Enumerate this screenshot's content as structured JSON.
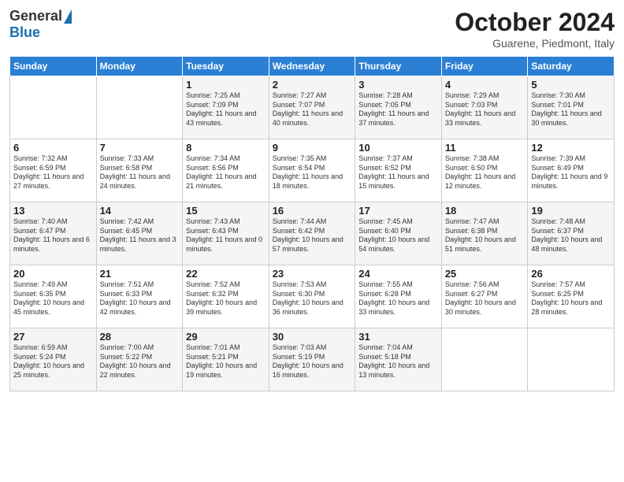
{
  "header": {
    "logo_general": "General",
    "logo_blue": "Blue",
    "title": "October 2024",
    "location": "Guarene, Piedmont, Italy"
  },
  "weekdays": [
    "Sunday",
    "Monday",
    "Tuesday",
    "Wednesday",
    "Thursday",
    "Friday",
    "Saturday"
  ],
  "weeks": [
    [
      {
        "day": "",
        "info": ""
      },
      {
        "day": "",
        "info": ""
      },
      {
        "day": "1",
        "info": "Sunrise: 7:25 AM\nSunset: 7:09 PM\nDaylight: 11 hours and 43 minutes."
      },
      {
        "day": "2",
        "info": "Sunrise: 7:27 AM\nSunset: 7:07 PM\nDaylight: 11 hours and 40 minutes."
      },
      {
        "day": "3",
        "info": "Sunrise: 7:28 AM\nSunset: 7:05 PM\nDaylight: 11 hours and 37 minutes."
      },
      {
        "day": "4",
        "info": "Sunrise: 7:29 AM\nSunset: 7:03 PM\nDaylight: 11 hours and 33 minutes."
      },
      {
        "day": "5",
        "info": "Sunrise: 7:30 AM\nSunset: 7:01 PM\nDaylight: 11 hours and 30 minutes."
      }
    ],
    [
      {
        "day": "6",
        "info": "Sunrise: 7:32 AM\nSunset: 6:59 PM\nDaylight: 11 hours and 27 minutes."
      },
      {
        "day": "7",
        "info": "Sunrise: 7:33 AM\nSunset: 6:58 PM\nDaylight: 11 hours and 24 minutes."
      },
      {
        "day": "8",
        "info": "Sunrise: 7:34 AM\nSunset: 6:56 PM\nDaylight: 11 hours and 21 minutes."
      },
      {
        "day": "9",
        "info": "Sunrise: 7:35 AM\nSunset: 6:54 PM\nDaylight: 11 hours and 18 minutes."
      },
      {
        "day": "10",
        "info": "Sunrise: 7:37 AM\nSunset: 6:52 PM\nDaylight: 11 hours and 15 minutes."
      },
      {
        "day": "11",
        "info": "Sunrise: 7:38 AM\nSunset: 6:50 PM\nDaylight: 11 hours and 12 minutes."
      },
      {
        "day": "12",
        "info": "Sunrise: 7:39 AM\nSunset: 6:49 PM\nDaylight: 11 hours and 9 minutes."
      }
    ],
    [
      {
        "day": "13",
        "info": "Sunrise: 7:40 AM\nSunset: 6:47 PM\nDaylight: 11 hours and 6 minutes."
      },
      {
        "day": "14",
        "info": "Sunrise: 7:42 AM\nSunset: 6:45 PM\nDaylight: 11 hours and 3 minutes."
      },
      {
        "day": "15",
        "info": "Sunrise: 7:43 AM\nSunset: 6:43 PM\nDaylight: 11 hours and 0 minutes."
      },
      {
        "day": "16",
        "info": "Sunrise: 7:44 AM\nSunset: 6:42 PM\nDaylight: 10 hours and 57 minutes."
      },
      {
        "day": "17",
        "info": "Sunrise: 7:45 AM\nSunset: 6:40 PM\nDaylight: 10 hours and 54 minutes."
      },
      {
        "day": "18",
        "info": "Sunrise: 7:47 AM\nSunset: 6:38 PM\nDaylight: 10 hours and 51 minutes."
      },
      {
        "day": "19",
        "info": "Sunrise: 7:48 AM\nSunset: 6:37 PM\nDaylight: 10 hours and 48 minutes."
      }
    ],
    [
      {
        "day": "20",
        "info": "Sunrise: 7:49 AM\nSunset: 6:35 PM\nDaylight: 10 hours and 45 minutes."
      },
      {
        "day": "21",
        "info": "Sunrise: 7:51 AM\nSunset: 6:33 PM\nDaylight: 10 hours and 42 minutes."
      },
      {
        "day": "22",
        "info": "Sunrise: 7:52 AM\nSunset: 6:32 PM\nDaylight: 10 hours and 39 minutes."
      },
      {
        "day": "23",
        "info": "Sunrise: 7:53 AM\nSunset: 6:30 PM\nDaylight: 10 hours and 36 minutes."
      },
      {
        "day": "24",
        "info": "Sunrise: 7:55 AM\nSunset: 6:28 PM\nDaylight: 10 hours and 33 minutes."
      },
      {
        "day": "25",
        "info": "Sunrise: 7:56 AM\nSunset: 6:27 PM\nDaylight: 10 hours and 30 minutes."
      },
      {
        "day": "26",
        "info": "Sunrise: 7:57 AM\nSunset: 6:25 PM\nDaylight: 10 hours and 28 minutes."
      }
    ],
    [
      {
        "day": "27",
        "info": "Sunrise: 6:59 AM\nSunset: 5:24 PM\nDaylight: 10 hours and 25 minutes."
      },
      {
        "day": "28",
        "info": "Sunrise: 7:00 AM\nSunset: 5:22 PM\nDaylight: 10 hours and 22 minutes."
      },
      {
        "day": "29",
        "info": "Sunrise: 7:01 AM\nSunset: 5:21 PM\nDaylight: 10 hours and 19 minutes."
      },
      {
        "day": "30",
        "info": "Sunrise: 7:03 AM\nSunset: 5:19 PM\nDaylight: 10 hours and 16 minutes."
      },
      {
        "day": "31",
        "info": "Sunrise: 7:04 AM\nSunset: 5:18 PM\nDaylight: 10 hours and 13 minutes."
      },
      {
        "day": "",
        "info": ""
      },
      {
        "day": "",
        "info": ""
      }
    ]
  ]
}
